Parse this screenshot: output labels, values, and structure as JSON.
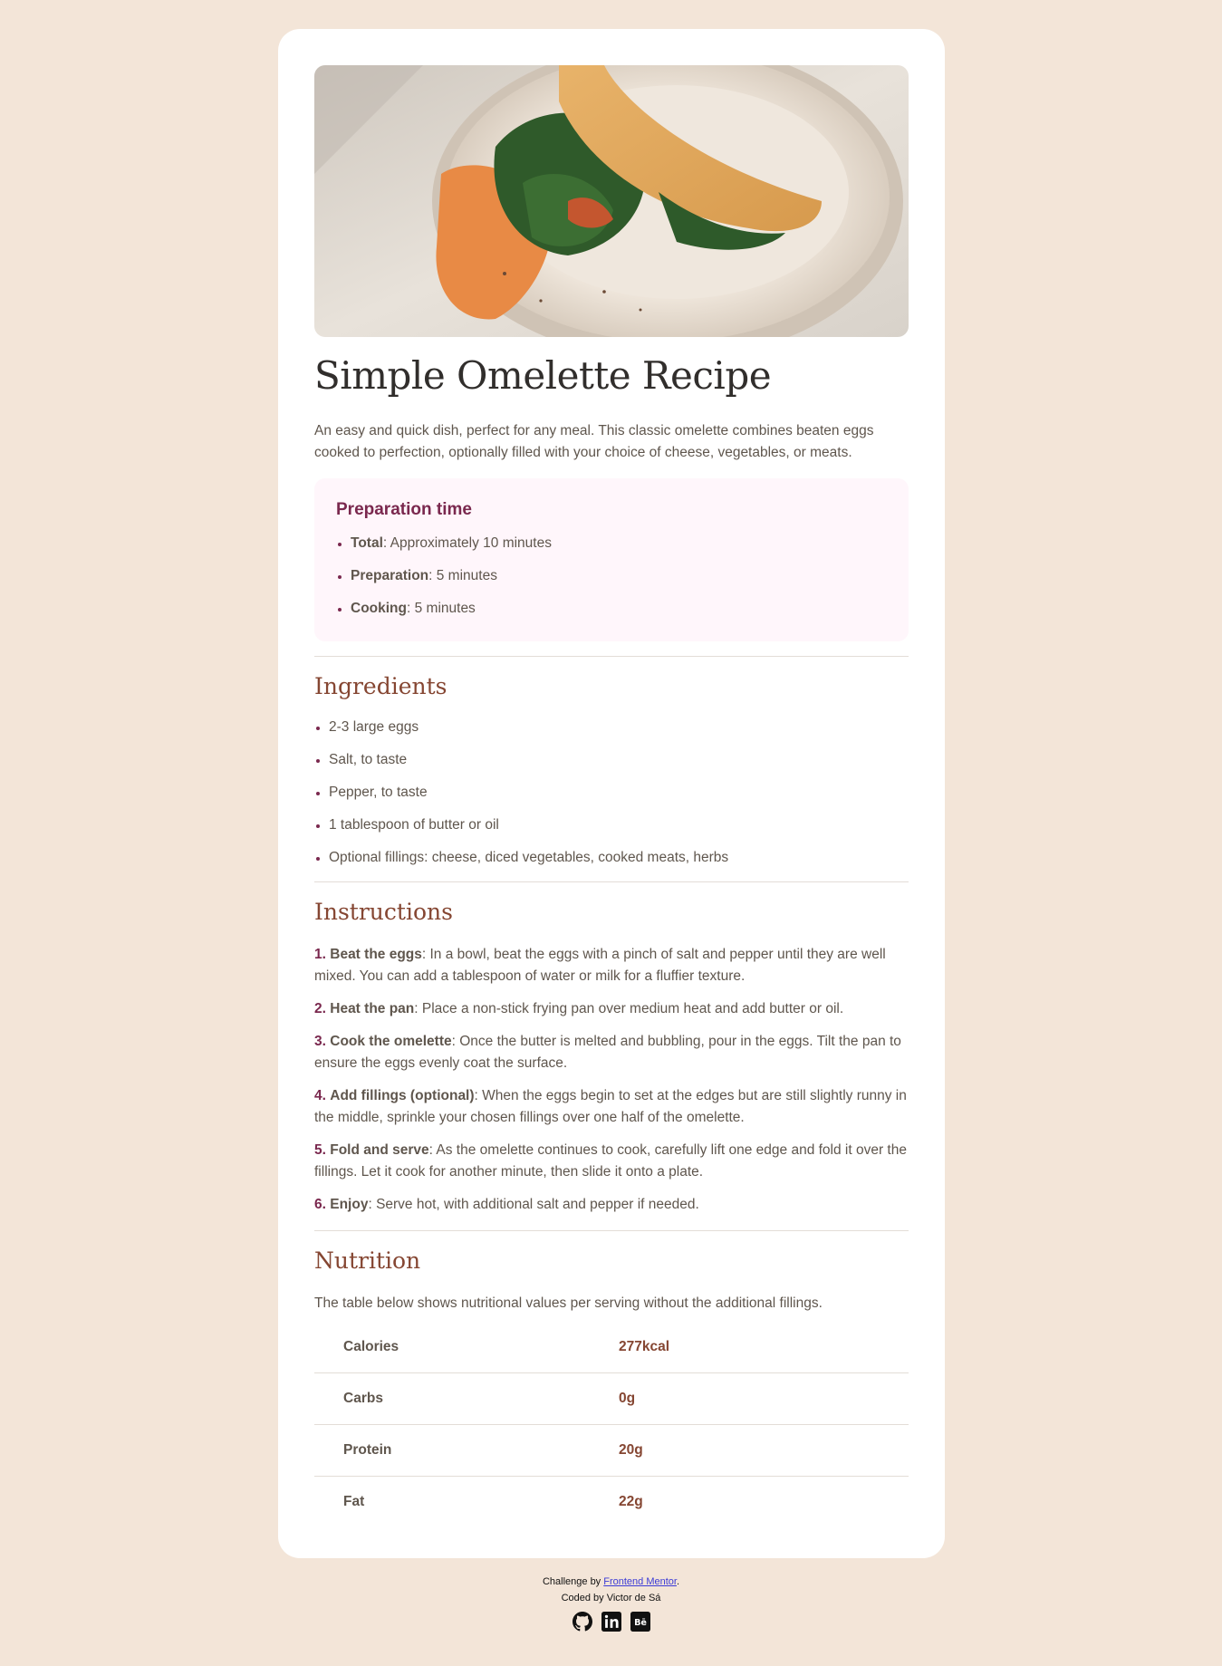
{
  "recipe": {
    "image_alt": "omelette-image",
    "title": "Simple Omelette Recipe",
    "description": "An easy and quick dish, perfect for any meal. This classic omelette combines beaten eggs cooked to perfection, optionally filled with your choice of cheese, vegetables, or meats."
  },
  "preparation": {
    "heading": "Preparation time",
    "items": [
      {
        "label": "Total",
        "value": ": Approximately 10 minutes"
      },
      {
        "label": "Preparation",
        "value": ": 5 minutes"
      },
      {
        "label": "Cooking",
        "value": ": 5 minutes"
      }
    ]
  },
  "ingredients": {
    "heading": "Ingredients",
    "items": [
      "2-3 large eggs",
      "Salt, to taste",
      "Pepper, to taste",
      "1 tablespoon of butter or oil",
      "Optional fillings: cheese, diced vegetables, cooked meats, herbs"
    ]
  },
  "instructions": {
    "heading": "Instructions",
    "steps": [
      {
        "num": "1.",
        "title": "Beat the eggs",
        "text": ": In a bowl, beat the eggs with a pinch of salt and pepper until they are well mixed. You can add a tablespoon of water or milk for a fluffier texture."
      },
      {
        "num": "2.",
        "title": "Heat the pan",
        "text": ": Place a non-stick frying pan over medium heat and add butter or oil."
      },
      {
        "num": "3.",
        "title": "Cook the omelette",
        "text": ": Once the butter is melted and bubbling, pour in the eggs. Tilt the pan to ensure the eggs evenly coat the surface."
      },
      {
        "num": "4.",
        "title": "Add fillings (optional)",
        "text": ": When the eggs begin to set at the edges but are still slightly runny in the middle, sprinkle your chosen fillings over one half of the omelette."
      },
      {
        "num": "5.",
        "title": "Fold and serve",
        "text": ": As the omelette continues to cook, carefully lift one edge and fold it over the fillings. Let it cook for another minute, then slide it onto a plate."
      },
      {
        "num": "6.",
        "title": "Enjoy",
        "text": ": Serve hot, with additional salt and pepper if needed."
      }
    ]
  },
  "nutrition": {
    "heading": "Nutrition",
    "intro": "The table below shows nutritional values per serving without the additional fillings.",
    "rows": [
      {
        "label": "Calories",
        "value": "277kcal"
      },
      {
        "label": "Carbs",
        "value": "0g"
      },
      {
        "label": "Protein",
        "value": "20g"
      },
      {
        "label": "Fat",
        "value": "22g"
      }
    ]
  },
  "footer": {
    "challenge_prefix": "Challenge by ",
    "challenge_link": "Frontend Mentor",
    "challenge_suffix": ".",
    "coded_by": "Coded by Victor de Sá",
    "social_icons": [
      "github-icon",
      "linkedin-icon",
      "behance-icon"
    ]
  },
  "colors": {
    "background": "#f3e5d8",
    "card": "#ffffff",
    "heading_brown": "#854632",
    "accent_plum": "#7a284e",
    "prep_bg": "#fff6fb",
    "title_dark": "#312e2c",
    "body_text": "#5f564d"
  }
}
